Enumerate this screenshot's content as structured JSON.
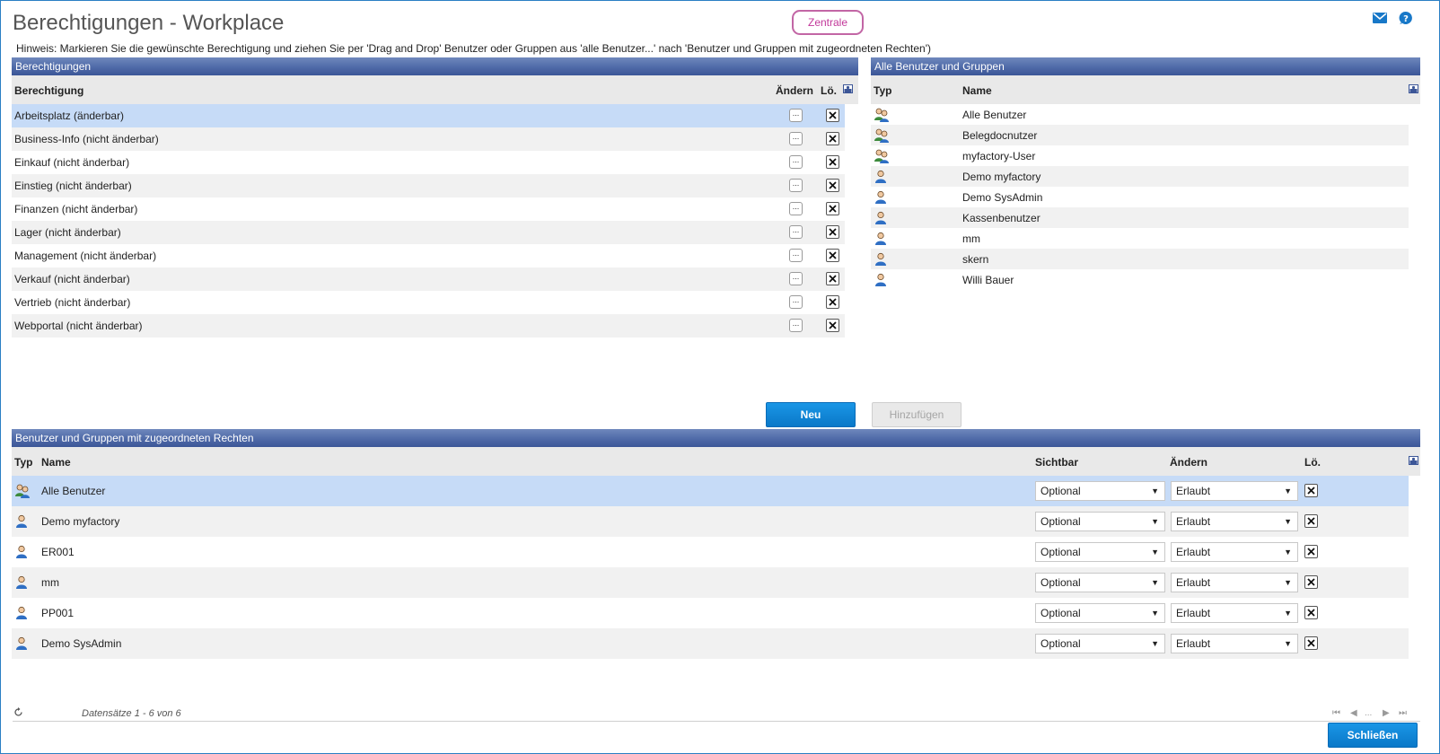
{
  "page": {
    "title": "Berechtigungen - Workplace",
    "badge": "Zentrale",
    "hint": "Hinweis: Markieren Sie die gewünschte Berechtigung und ziehen Sie per 'Drag and Drop' Benutzer oder Gruppen aus 'alle Benutzer...' nach 'Benutzer und Gruppen mit zugeordneten Rechten')"
  },
  "icons": {
    "mail": "mail-icon",
    "help": "help-icon",
    "column_config": "column-config-icon",
    "group": "user-group-icon",
    "user": "user-icon",
    "refresh": "refresh-icon"
  },
  "colors": {
    "header": "#4f6aa8",
    "selected_row": "#c6dbf7",
    "primary_button": "#0a78c8",
    "badge": "#c2389a"
  },
  "permissions": {
    "title": "Berechtigungen",
    "columns": {
      "name": "Berechtigung",
      "edit": "Ändern",
      "delete": "Lö."
    },
    "edit_label": "...",
    "rows": [
      {
        "name": "Arbeitsplatz (änderbar)",
        "selected": true
      },
      {
        "name": "Business-Info (nicht änderbar)"
      },
      {
        "name": "Einkauf (nicht änderbar)"
      },
      {
        "name": "Einstieg (nicht änderbar)"
      },
      {
        "name": "Finanzen (nicht änderbar)"
      },
      {
        "name": "Lager (nicht änderbar)"
      },
      {
        "name": "Management (nicht änderbar)"
      },
      {
        "name": "Verkauf (nicht änderbar)"
      },
      {
        "name": "Vertrieb (nicht änderbar)"
      },
      {
        "name": "Webportal (nicht änderbar)"
      }
    ]
  },
  "all_users": {
    "title": "Alle Benutzer und Gruppen",
    "columns": {
      "type": "Typ",
      "name": "Name"
    },
    "rows": [
      {
        "type": "group",
        "name": "Alle Benutzer"
      },
      {
        "type": "group",
        "name": "Belegdocnutzer"
      },
      {
        "type": "group",
        "name": "myfactory-User"
      },
      {
        "type": "user",
        "name": "Demo myfactory"
      },
      {
        "type": "user",
        "name": "Demo SysAdmin"
      },
      {
        "type": "user",
        "name": "Kassenbenutzer"
      },
      {
        "type": "user",
        "name": "mm"
      },
      {
        "type": "user",
        "name": "skern"
      },
      {
        "type": "user",
        "name": "Willi Bauer"
      }
    ]
  },
  "buttons": {
    "new": "Neu",
    "add": "Hinzufügen",
    "close": "Schließen"
  },
  "assigned": {
    "title": "Benutzer und Gruppen mit zugeordneten Rechten",
    "columns": {
      "type": "Typ",
      "name": "Name",
      "visible": "Sichtbar",
      "edit": "Ändern",
      "delete": "Lö."
    },
    "rows": [
      {
        "type": "group",
        "name": "Alle Benutzer",
        "visible": "Optional",
        "edit": "Erlaubt",
        "selected": true
      },
      {
        "type": "user",
        "name": "Demo myfactory",
        "visible": "Optional",
        "edit": "Erlaubt"
      },
      {
        "type": "user",
        "name": "ER001",
        "visible": "Optional",
        "edit": "Erlaubt"
      },
      {
        "type": "user",
        "name": "mm",
        "visible": "Optional",
        "edit": "Erlaubt"
      },
      {
        "type": "user",
        "name": "PP001",
        "visible": "Optional",
        "edit": "Erlaubt"
      },
      {
        "type": "user",
        "name": "Demo SysAdmin",
        "visible": "Optional",
        "edit": "Erlaubt"
      }
    ]
  },
  "footer": {
    "records": "Datensätze 1 - 6 von 6",
    "pager": {
      "first": "⏮",
      "prev": "◀",
      "ellipsis": "...",
      "next": "▶",
      "last": "⏭"
    }
  }
}
